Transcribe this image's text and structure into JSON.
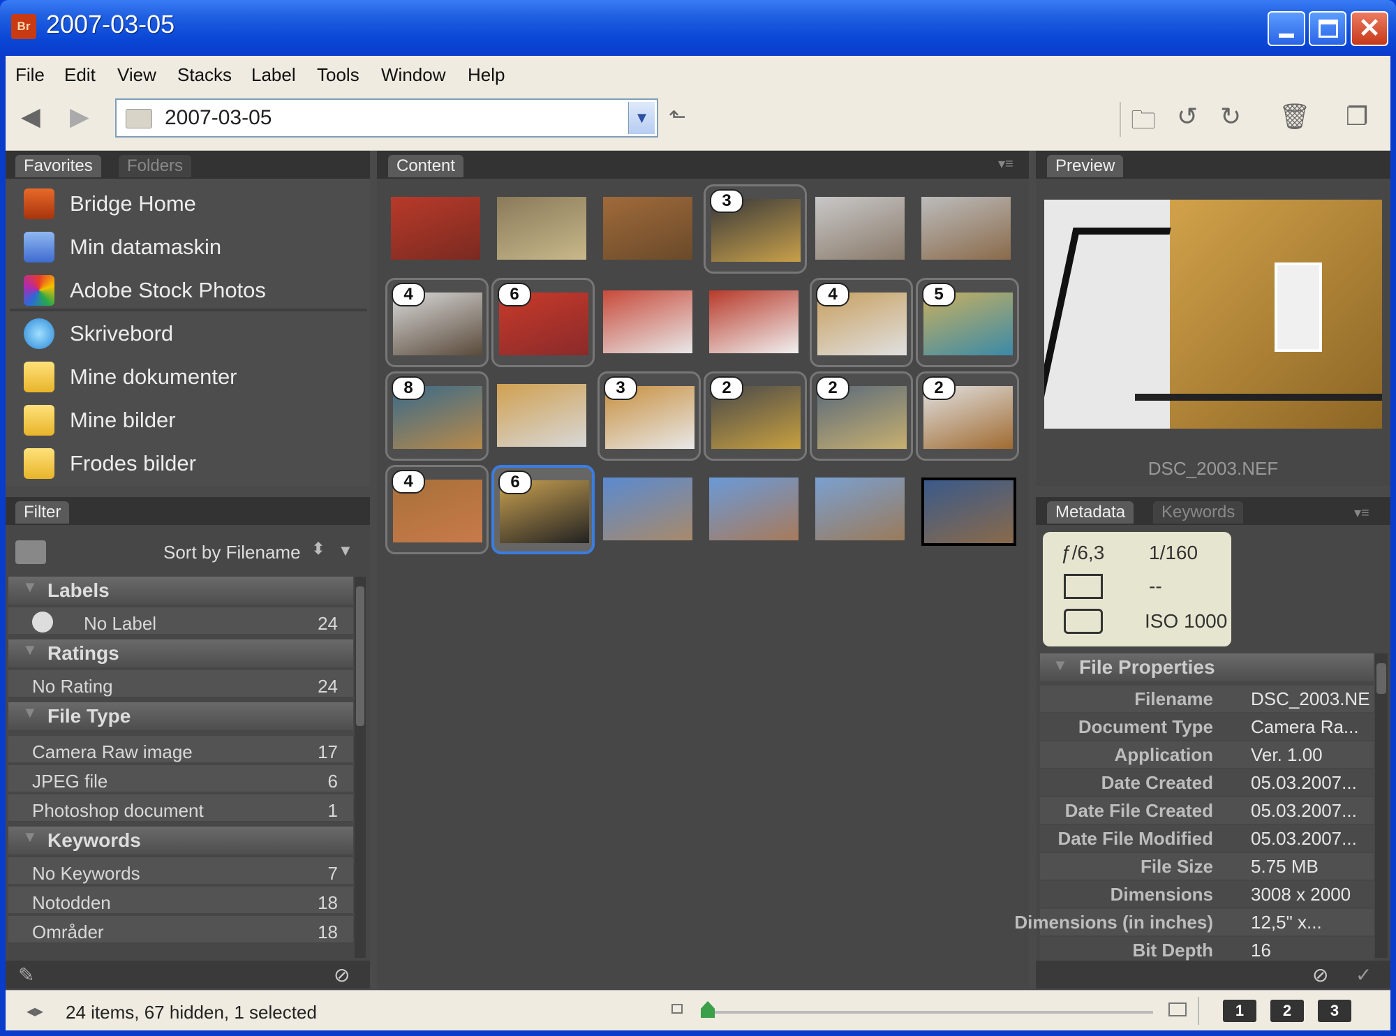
{
  "window": {
    "title": "2007-03-05",
    "app_icon": "Br"
  },
  "menu": [
    "File",
    "Edit",
    "View",
    "Stacks",
    "Label",
    "Tools",
    "Window",
    "Help"
  ],
  "toolbar": {
    "path": "2007-03-05"
  },
  "left_panel": {
    "tabs": [
      "Favorites",
      "Folders"
    ],
    "favorites": [
      "Bridge Home",
      "Min datamaskin",
      "Adobe Stock Photos",
      "Skrivebord",
      "Mine dokumenter",
      "Mine bilder",
      "Frodes bilder"
    ]
  },
  "filter": {
    "tab": "Filter",
    "sort": "Sort by Filename",
    "groups": [
      {
        "title": "Labels",
        "rows": [
          {
            "label": "No Label",
            "count": "24"
          }
        ]
      },
      {
        "title": "Ratings",
        "rows": [
          {
            "label": "No Rating",
            "count": "24"
          }
        ]
      },
      {
        "title": "File Type",
        "rows": [
          {
            "label": "Camera Raw image",
            "count": "17"
          },
          {
            "label": "JPEG file",
            "count": "6"
          },
          {
            "label": "Photoshop document",
            "count": "1"
          }
        ]
      },
      {
        "title": "Keywords",
        "rows": [
          {
            "label": "No Keywords",
            "count": "7"
          },
          {
            "label": "Notodden",
            "count": "18"
          },
          {
            "label": "Områder",
            "count": "18"
          }
        ]
      }
    ]
  },
  "content": {
    "tab": "Content",
    "thumbs": [
      {
        "badge": ""
      },
      {
        "badge": ""
      },
      {
        "badge": ""
      },
      {
        "badge": "3"
      },
      {
        "badge": ""
      },
      {
        "badge": ""
      },
      {
        "badge": "4"
      },
      {
        "badge": "6"
      },
      {
        "badge": ""
      },
      {
        "badge": ""
      },
      {
        "badge": "4"
      },
      {
        "badge": "5"
      },
      {
        "badge": "8"
      },
      {
        "badge": ""
      },
      {
        "badge": "3"
      },
      {
        "badge": "2"
      },
      {
        "badge": "2"
      },
      {
        "badge": "2"
      },
      {
        "badge": "4"
      },
      {
        "badge": "6"
      },
      {
        "badge": ""
      },
      {
        "badge": ""
      },
      {
        "badge": ""
      },
      {
        "badge": ""
      }
    ]
  },
  "preview": {
    "tab": "Preview",
    "filename": "DSC_2003.NEF"
  },
  "metadata": {
    "tabs": [
      "Metadata",
      "Keywords"
    ],
    "camera": {
      "aperture": "ƒ/6,3",
      "shutter": "1/160",
      "metering": "--",
      "iso": "ISO 1000"
    },
    "section": "File Properties",
    "rows": [
      {
        "key": "Filename",
        "value": "DSC_2003.NE"
      },
      {
        "key": "Document Type",
        "value": "Camera Ra..."
      },
      {
        "key": "Application",
        "value": "Ver. 1.00"
      },
      {
        "key": "Date Created",
        "value": "05.03.2007..."
      },
      {
        "key": "Date File Created",
        "value": "05.03.2007..."
      },
      {
        "key": "Date File Modified",
        "value": "05.03.2007..."
      },
      {
        "key": "File Size",
        "value": "5.75 MB"
      },
      {
        "key": "Dimensions",
        "value": "3008 x 2000"
      },
      {
        "key": "Dimensions (in inches)",
        "value": "12,5\" x..."
      },
      {
        "key": "Bit Depth",
        "value": "16"
      }
    ]
  },
  "status": {
    "text": "24 items, 67 hidden, 1 selected",
    "views": [
      "1",
      "2",
      "3"
    ]
  }
}
